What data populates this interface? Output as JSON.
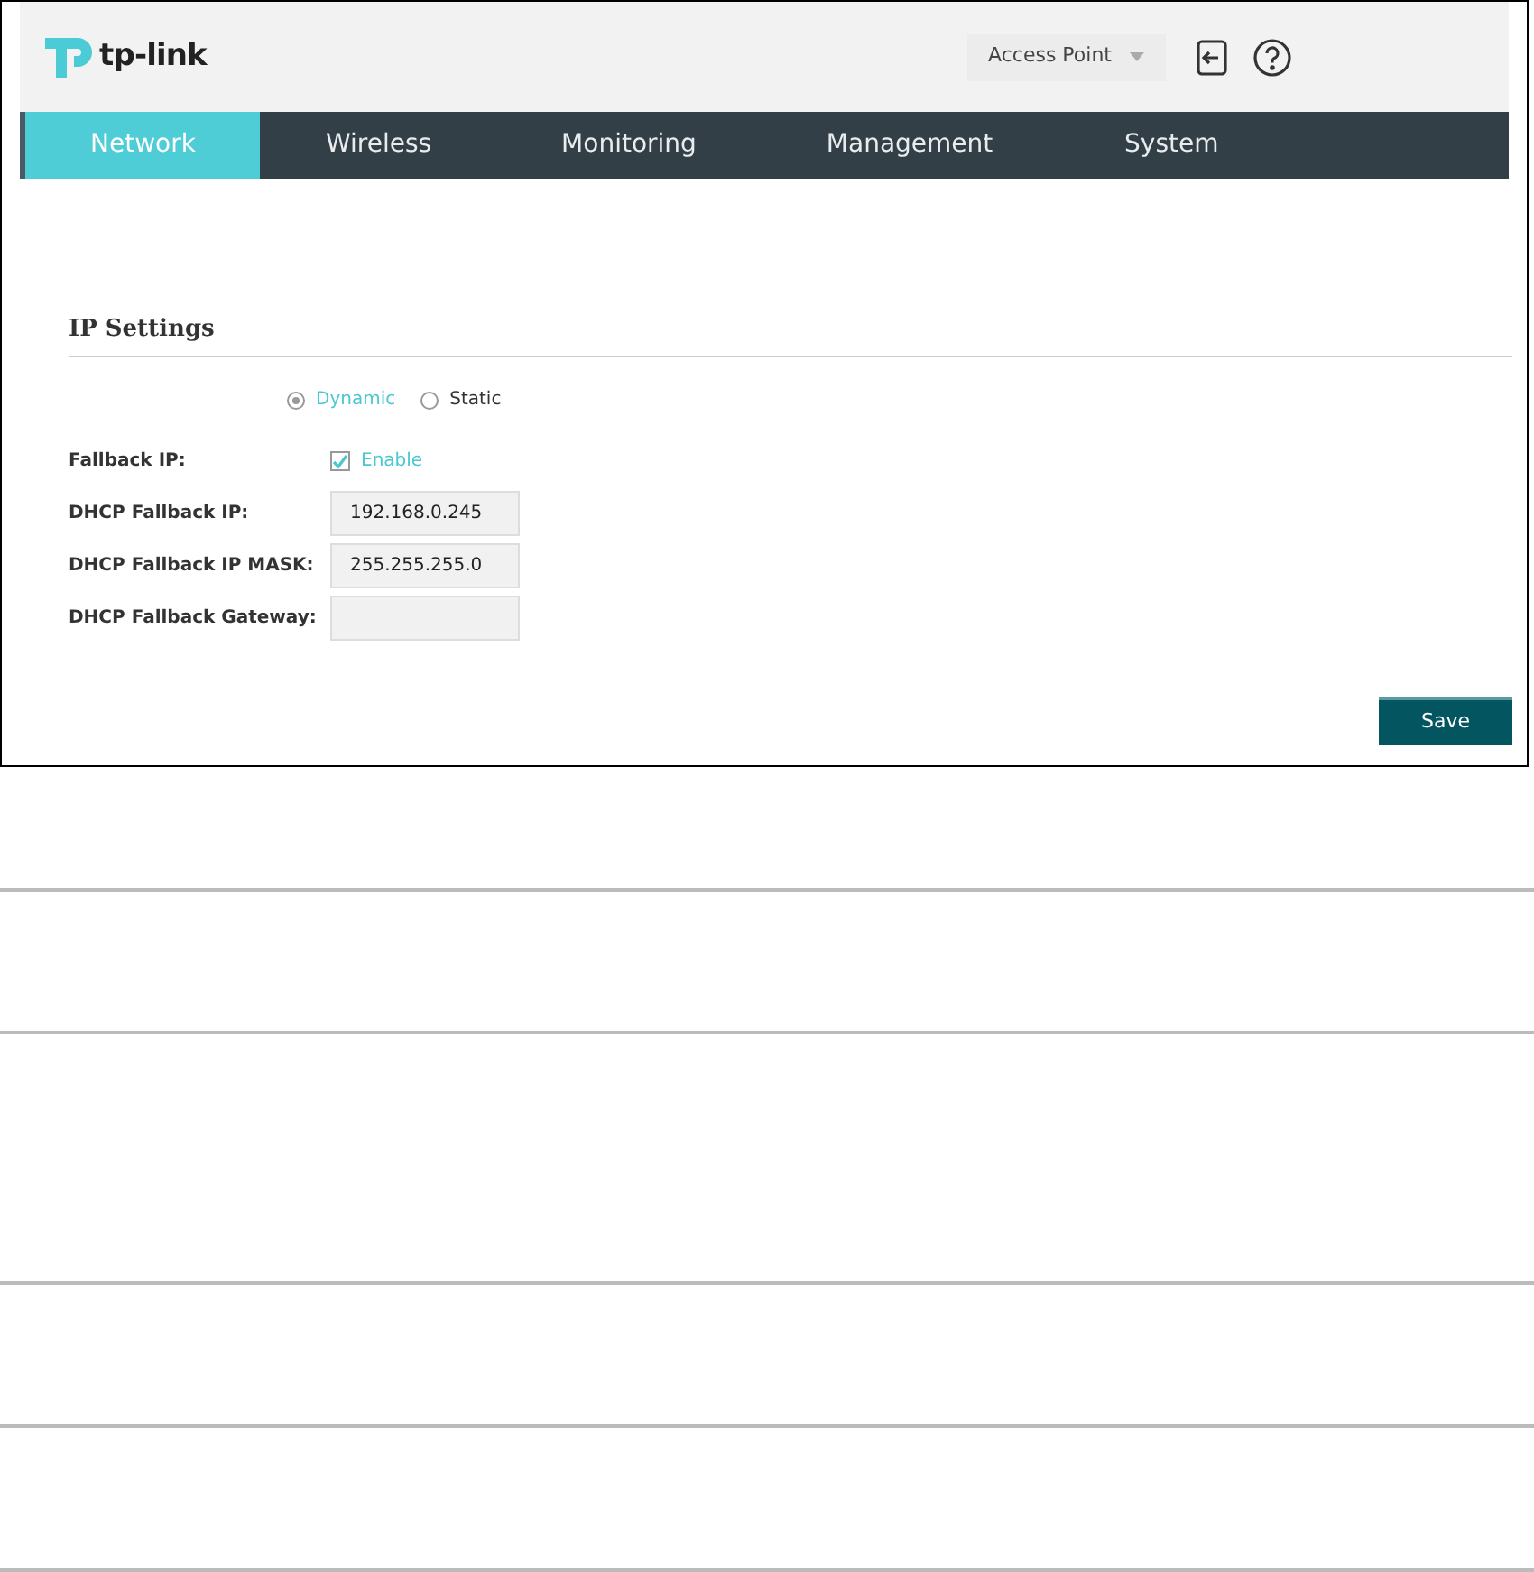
{
  "header": {
    "logo_text": "tp-link",
    "mode_select": "Access Point"
  },
  "tabs": [
    {
      "label": "Network",
      "selected": true
    },
    {
      "label": "Wireless",
      "selected": false
    },
    {
      "label": "Monitoring",
      "selected": false
    },
    {
      "label": "Management",
      "selected": false
    },
    {
      "label": "System",
      "selected": false
    }
  ],
  "section": {
    "title": "IP Settings",
    "mode_options": [
      {
        "label": "Dynamic",
        "selected": true
      },
      {
        "label": "Static",
        "selected": false
      }
    ],
    "rows": [
      {
        "kind": "checkbox",
        "label": "Fallback IP:",
        "option": "Enable",
        "checked": true
      },
      {
        "kind": "input",
        "label": "DHCP Fallback IP:",
        "value": "192.168.0.245"
      },
      {
        "kind": "input",
        "label": "DHCP Fallback IP MASK:",
        "value": "255.255.255.0"
      },
      {
        "kind": "input",
        "label": "DHCP Fallback Gateway:"
      }
    ]
  },
  "save_button": "Save"
}
